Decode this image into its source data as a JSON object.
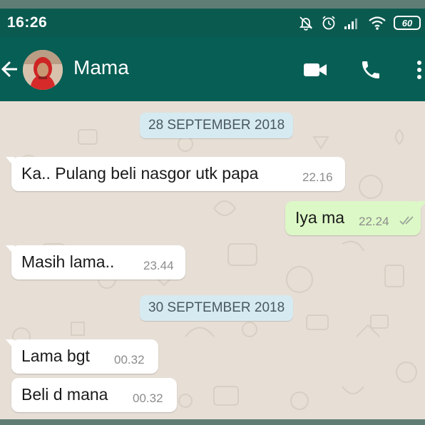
{
  "status_bar": {
    "time": "16:26",
    "battery": "60",
    "icons": [
      "mute-icon",
      "alarm-icon",
      "signal-icon",
      "wifi-icon",
      "battery-icon"
    ]
  },
  "header": {
    "contact_name": "Mama",
    "back_icon": "back-arrow-icon",
    "actions": [
      "video-call-icon",
      "phone-icon",
      "more-options-icon"
    ],
    "colors": {
      "bar": "#075e54",
      "status": "#0b5a50"
    }
  },
  "chat": {
    "dates": [
      "28 SEPTEMBER 2018",
      "30 SEPTEMBER 2018"
    ],
    "messages": [
      {
        "text": "Ka.. Pulang beli nasgor utk papa",
        "time": "22.16",
        "direction": "incoming"
      },
      {
        "text": "Iya ma",
        "time": "22.24",
        "direction": "outgoing",
        "status": "double-check-icon"
      },
      {
        "text": "Masih lama..",
        "time": "23.44",
        "direction": "incoming"
      },
      {
        "text": "Lama bgt",
        "time": "00.32",
        "direction": "incoming"
      },
      {
        "text": "Beli d mana",
        "time": "00.32",
        "direction": "incoming"
      }
    ],
    "colors": {
      "incoming": "#ffffff",
      "outgoing": "#dcf8c6",
      "date_chip": "#d6eaf1",
      "wallpaper": "#e7dfd6"
    }
  }
}
